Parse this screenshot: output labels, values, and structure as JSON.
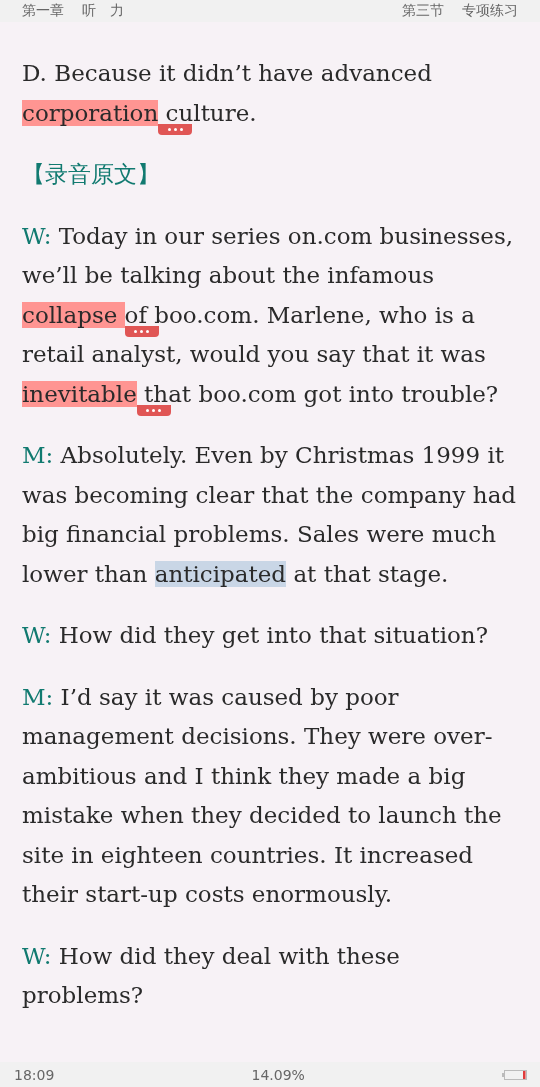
{
  "header": {
    "chapter": "第一章",
    "chapter_title": "听　力",
    "section": "第三节",
    "section_title": "专项练习"
  },
  "paragraphs": [
    {
      "kind": "text",
      "segments": [
        {
          "kind": "plain",
          "text": "D. Because it didn’t have advanced "
        },
        {
          "kind": "note",
          "text": "corporation"
        },
        {
          "kind": "plain",
          "text": " culture."
        }
      ]
    },
    {
      "kind": "heading",
      "segments": [
        {
          "kind": "plain",
          "text": "【录音原文】"
        }
      ]
    },
    {
      "kind": "text",
      "segments": [
        {
          "kind": "speaker",
          "text": "W:"
        },
        {
          "kind": "plain",
          "text": " Today in our series on.com businesses, we’ll be talking about the infamous "
        },
        {
          "kind": "note",
          "text": "collapse "
        },
        {
          "kind": "plain",
          "text": "of boo.com. Marlene, who is a retail analyst, would you say that it was "
        },
        {
          "kind": "note",
          "text": "inevitable"
        },
        {
          "kind": "plain",
          "text": " that boo.com got into trouble?"
        }
      ]
    },
    {
      "kind": "text",
      "segments": [
        {
          "kind": "speaker",
          "text": "M:"
        },
        {
          "kind": "plain",
          "text": " Absolutely. Even by Christmas 1999 it was becoming clear that the company had big financial problems. Sales were much lower than "
        },
        {
          "kind": "selection",
          "text": "anticipated"
        },
        {
          "kind": "plain",
          "text": " at that stage."
        }
      ]
    },
    {
      "kind": "text",
      "segments": [
        {
          "kind": "speaker",
          "text": "W:"
        },
        {
          "kind": "plain",
          "text": " How did they get into that situation?"
        }
      ]
    },
    {
      "kind": "text",
      "segments": [
        {
          "kind": "speaker",
          "text": "M:"
        },
        {
          "kind": "plain",
          "text": " I’d say it was caused by poor management decisions. They were over-ambitious and I think they made a big mistake when they decided to launch the site in eighteen countries. It increased their start-up costs enormously."
        }
      ]
    },
    {
      "kind": "text",
      "segments": [
        {
          "kind": "speaker",
          "text": "W:"
        },
        {
          "kind": "plain",
          "text": " How did they deal with these problems?"
        }
      ]
    }
  ],
  "footer": {
    "time": "18:09",
    "progress": "14.09%"
  }
}
